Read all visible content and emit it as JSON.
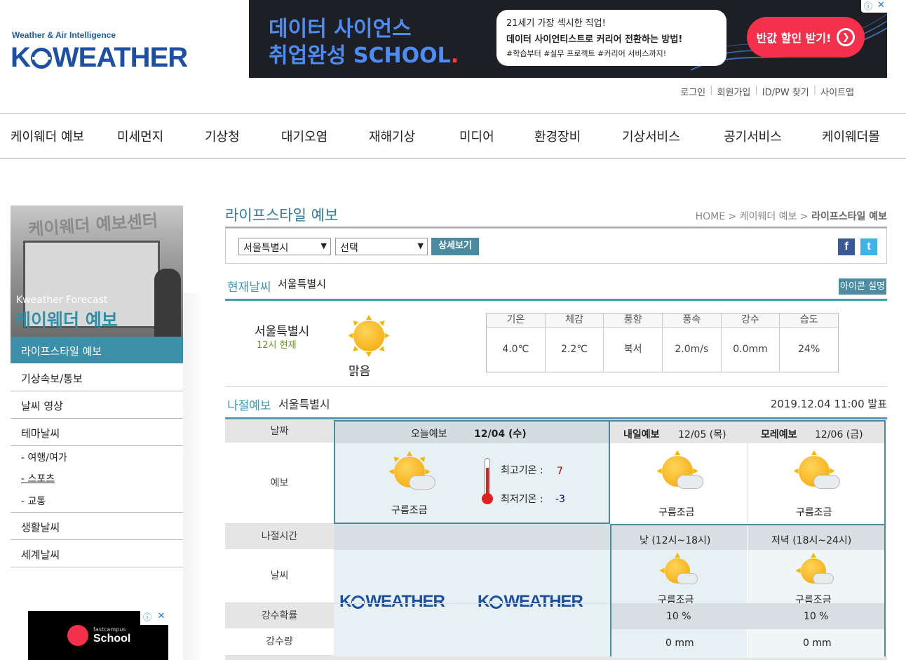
{
  "header": {
    "logo_tagline": "Weather & Air Intelligence",
    "logo_pre": "K",
    "logo_post": "WEATHER",
    "ad": {
      "headline1": "데이터 사이언스",
      "headline2": "취업완성 SCHOOL",
      "headline2_dot": ".",
      "bubble_line1": "21세기 가장 섹시한 직업!",
      "bubble_line2": "데이터 사이언티스트로 커리어 전환하는 방법!",
      "bubble_line3": "#학습부터 #실무 프로젝트 #커리어 서비스까지!",
      "cta": "반값 할인 받기!"
    },
    "util_links": [
      "로그인",
      "회원가입",
      "ID/PW 찾기",
      "사이트맵"
    ]
  },
  "gnb": [
    "케이웨더 예보",
    "미세먼지",
    "기상청",
    "대기오염",
    "재해기상",
    "미디어",
    "환경장비",
    "기상서비스",
    "공기서비스",
    "케이웨더몰"
  ],
  "sidebar": {
    "banner_big": "케이웨더 예보센터",
    "banner_small": "Kweather Forecast",
    "banner_title": "케이웨더 예보",
    "active": "라이프스타일 예보",
    "items": [
      "기상속보/통보",
      "날씨 영상",
      "테마날씨",
      "생활날씨",
      "세계날씨"
    ],
    "sub_items": [
      "- 여행/여가",
      "- 스포츠",
      "- 교통"
    ],
    "ad_small": {
      "top": "fastcampus",
      "name": "School"
    }
  },
  "main": {
    "title": "라이프스타일 예보",
    "breadcrumb": [
      "HOME",
      "케이웨더 예보",
      "라이프스타일 예보"
    ],
    "region_select": "서울특별시",
    "sub_select": "선택",
    "detail_button": "상세보기",
    "icon_button": "아이콘 설명",
    "current": {
      "label": "현재날씨",
      "city": "서울특별시",
      "time": "12시 현재",
      "desc": "맑음",
      "headers": [
        "기온",
        "체감",
        "풍향",
        "풍속",
        "강수",
        "습도"
      ],
      "values": [
        "4.0℃",
        "2.2℃",
        "북서",
        "2.0m/s",
        "0.0mm",
        "24%"
      ]
    },
    "forecast": {
      "label": "나절예보",
      "city": "서울특별시",
      "issued": "2019.12.04 11:00 발표",
      "row_headers": [
        "날짜",
        "예보",
        "나절시간",
        "날씨",
        "강수확률",
        "강수량"
      ],
      "today_label": "오늘예보",
      "today_date": "12/04 (수)",
      "today_desc": "구름조금",
      "max_label": "최고기온 :",
      "max_value": "7",
      "min_label": "최저기온 :",
      "min_value": "-3",
      "tomorrow_label": "내일예보",
      "tomorrow_date": "12/05 (목)",
      "tomorrow_desc": "구름조금",
      "dayafter_label": "모레예보",
      "dayafter_date": "12/06 (금)",
      "dayafter_desc": "구름조금",
      "slot1": "낮 (12시~18시)",
      "slot2": "저녁 (18시~24시)",
      "slot1_desc": "구름조금",
      "slot2_desc": "구름조금",
      "slot1_prob": "10 %",
      "slot2_prob": "10 %",
      "slot1_amt": "0 mm",
      "slot2_amt": "0 mm"
    }
  },
  "colors": {
    "brand": "#1d4fa3",
    "accent": "#3b8fa8",
    "max_temp": "#c00000",
    "min_temp": "#0000c0"
  }
}
